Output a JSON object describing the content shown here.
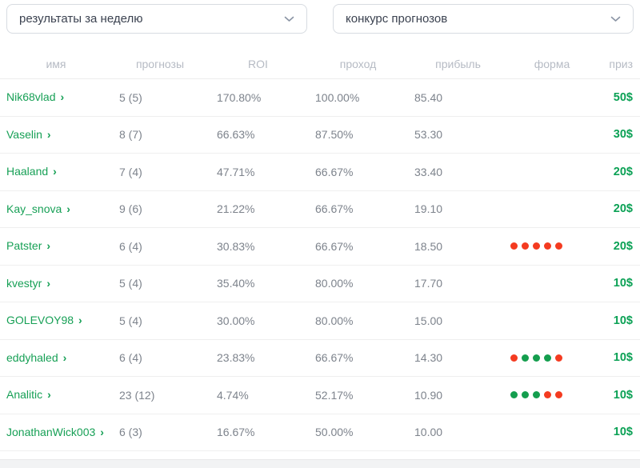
{
  "filters": {
    "period": {
      "value": "результаты за неделю"
    },
    "contest": {
      "value": "конкурс прогнозов"
    }
  },
  "table": {
    "headers": [
      "имя",
      "прогнозы",
      "ROI",
      "проход",
      "прибыль",
      "форма",
      "приз"
    ],
    "rows": [
      {
        "name": "Nik68vlad",
        "predictions": "5 (5)",
        "roi": "170.80%",
        "pass": "100.00%",
        "profit": "85.40",
        "form": [],
        "prize": "50$"
      },
      {
        "name": "Vaselin",
        "predictions": "8 (7)",
        "roi": "66.63%",
        "pass": "87.50%",
        "profit": "53.30",
        "form": [],
        "prize": "30$"
      },
      {
        "name": "Haaland",
        "predictions": "7 (4)",
        "roi": "47.71%",
        "pass": "66.67%",
        "profit": "33.40",
        "form": [],
        "prize": "20$"
      },
      {
        "name": "Kay_snova",
        "predictions": "9 (6)",
        "roi": "21.22%",
        "pass": "66.67%",
        "profit": "19.10",
        "form": [],
        "prize": "20$"
      },
      {
        "name": "Patster",
        "predictions": "6 (4)",
        "roi": "30.83%",
        "pass": "66.67%",
        "profit": "18.50",
        "form": [
          "red",
          "red",
          "red",
          "red",
          "red"
        ],
        "prize": "20$"
      },
      {
        "name": "kvestyr",
        "predictions": "5 (4)",
        "roi": "35.40%",
        "pass": "80.00%",
        "profit": "17.70",
        "form": [],
        "prize": "10$"
      },
      {
        "name": "GOLEVOY98",
        "predictions": "5 (4)",
        "roi": "30.00%",
        "pass": "80.00%",
        "profit": "15.00",
        "form": [],
        "prize": "10$"
      },
      {
        "name": "eddyhaled",
        "predictions": "6 (4)",
        "roi": "23.83%",
        "pass": "66.67%",
        "profit": "14.30",
        "form": [
          "red",
          "green",
          "green",
          "green",
          "red"
        ],
        "prize": "10$"
      },
      {
        "name": "Analitic",
        "predictions": "23 (12)",
        "roi": "4.74%",
        "pass": "52.17%",
        "profit": "10.90",
        "form": [
          "green",
          "green",
          "green",
          "red",
          "red"
        ],
        "prize": "10$"
      },
      {
        "name": "JonathanWick003",
        "predictions": "6 (3)",
        "roi": "16.67%",
        "pass": "50.00%",
        "profit": "10.00",
        "form": [],
        "prize": "10$"
      }
    ]
  },
  "icons": {
    "name_chevron": "›"
  },
  "colors": {
    "accent_green": "#17a056",
    "dot_red": "#f43b20",
    "dot_green": "#149e4e"
  }
}
